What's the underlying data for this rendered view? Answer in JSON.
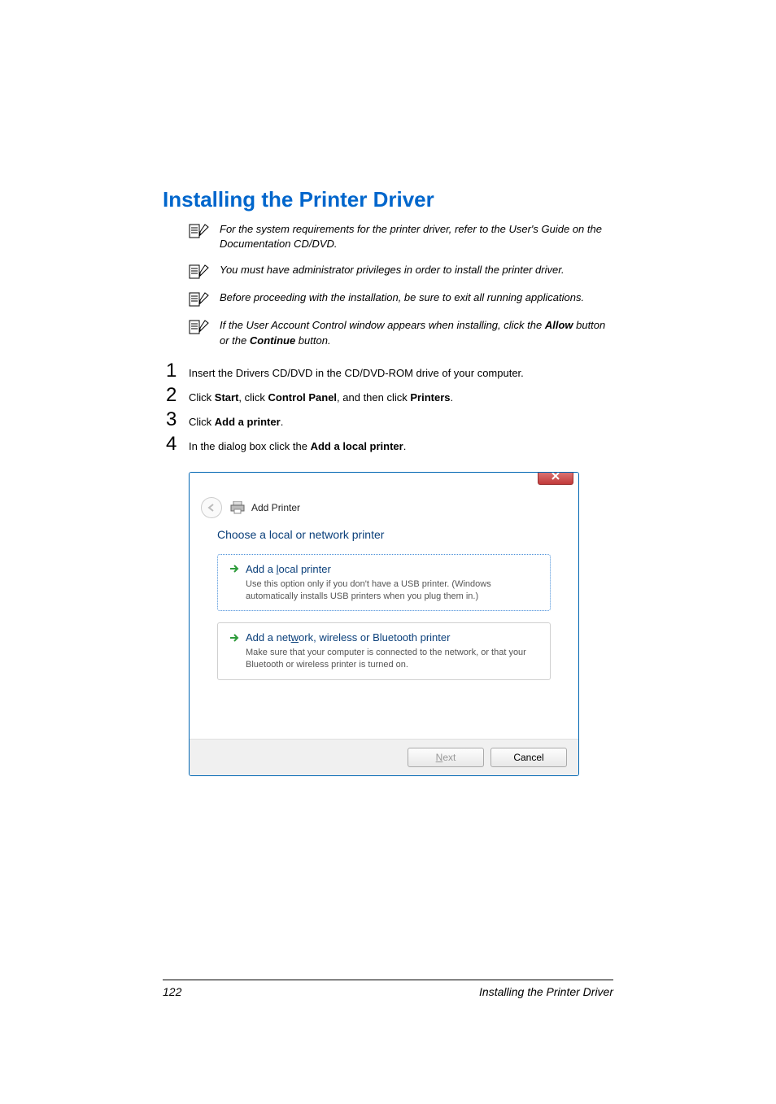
{
  "heading": "Installing the Printer Driver",
  "notes": [
    "For the system requirements for the printer driver, refer to the User's Guide on the Documentation CD/DVD.",
    "You must have administrator privileges in order to install the printer driver.",
    "Before proceeding with the installation, be sure to exit all running applications."
  ],
  "note4": {
    "pre": "If the User Account Control window appears when installing, click the ",
    "b1": "Allow",
    "mid": " button or the ",
    "b2": "Continue",
    "post": " button."
  },
  "steps": {
    "s1": "Insert the Drivers CD/DVD in the CD/DVD-ROM drive of your computer.",
    "s2": {
      "pre": "Click ",
      "b1": "Start",
      "m1": ", click ",
      "b2": "Control Panel",
      "m2": ", and then click ",
      "b3": "Printers",
      "post": "."
    },
    "s3": {
      "pre": "Click ",
      "b1": "Add a printer",
      "post": "."
    },
    "s4": {
      "pre": "In the dialog box click the ",
      "b1": "Add a local printer",
      "post": "."
    }
  },
  "dialog": {
    "header_label": "Add Printer",
    "title": "Choose a local or network printer",
    "opt1": {
      "label_pre": "Add a ",
      "label_accel": "l",
      "label_post": "ocal printer",
      "desc": "Use this option only if you don't have a USB printer. (Windows automatically installs USB printers when you plug them in.)"
    },
    "opt2": {
      "label_pre": "Add a net",
      "label_accel": "w",
      "label_post": "ork, wireless or Bluetooth printer",
      "desc": "Make sure that your computer is connected to the network, or that your Bluetooth or wireless printer is turned on."
    },
    "next_accel": "N",
    "next_rest": "ext",
    "cancel": "Cancel"
  },
  "footer": {
    "page": "122",
    "title": "Installing the Printer Driver"
  }
}
